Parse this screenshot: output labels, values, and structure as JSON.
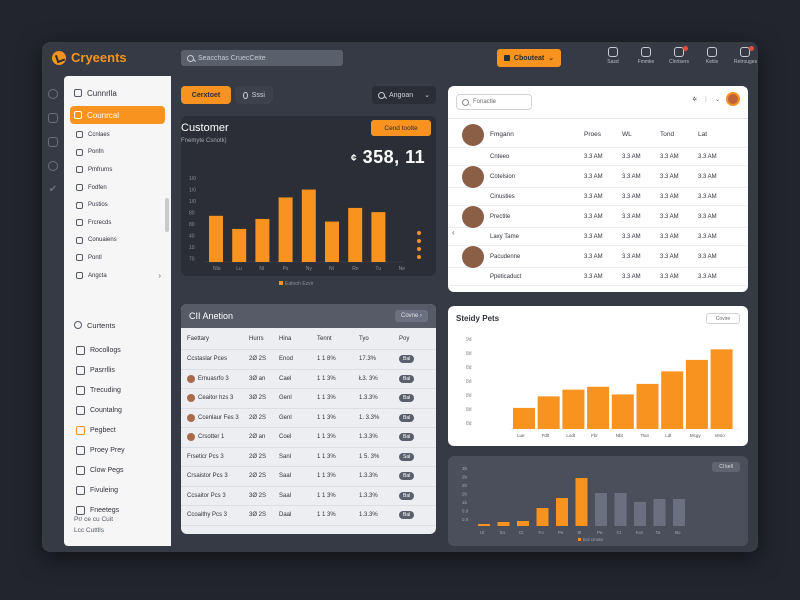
{
  "app": {
    "name": "Cryeents"
  },
  "search": {
    "placeholder": "Seacchas CruecCeite"
  },
  "top_dropdown": {
    "label": "Cbouteat"
  },
  "top_icons": [
    {
      "label": "Sasd",
      "icon": "bell-icon",
      "badge": false
    },
    {
      "label": "Fmmke",
      "icon": "chat-icon",
      "badge": false
    },
    {
      "label": "Clnrtsers",
      "icon": "calendar-icon",
      "badge": true
    },
    {
      "label": "Ketiis",
      "icon": "message-icon",
      "badge": false
    },
    {
      "label": "Retrouges",
      "icon": "user-icon",
      "badge": true
    }
  ],
  "sidebar": {
    "top_items": [
      {
        "label": "Cunnrlla",
        "icon": "home-icon"
      },
      {
        "label": "Counrcal",
        "icon": "customers-icon",
        "active": true
      }
    ],
    "items": [
      {
        "label": "Ccnlaes",
        "icon": "contacts-icon"
      },
      {
        "label": "Ponfn",
        "icon": "users-icon"
      },
      {
        "label": "Pmfrurns",
        "icon": "reports-icon"
      },
      {
        "label": "Fodfen",
        "icon": "folder-icon"
      },
      {
        "label": "Pustios",
        "icon": "settings-icon"
      },
      {
        "label": "Frcrecds",
        "icon": "records-icon"
      },
      {
        "label": "Conuaiens",
        "icon": "database-icon"
      },
      {
        "label": "Pontl",
        "icon": "file-icon"
      },
      {
        "label": "Angcta",
        "icon": "analytics-icon",
        "chevron": "›"
      }
    ],
    "section_title": "Curtents",
    "section_items": [
      {
        "label": "Rocollogs",
        "icon": "doc-icon"
      },
      {
        "label": "Pasrrllis",
        "icon": "user-icon"
      },
      {
        "label": "Trecuding",
        "icon": "calendar-icon"
      },
      {
        "label": "Countalng",
        "icon": "chart-icon"
      },
      {
        "label": "Pegbect",
        "icon": "megaphone-icon",
        "orange": true
      },
      {
        "label": "Proey Prey",
        "icon": "box-icon"
      },
      {
        "label": "Clow Pegs",
        "icon": "tag-icon"
      },
      {
        "label": "Fivuleing",
        "icon": "doc-icon"
      },
      {
        "label": "Fneetegs",
        "icon": "box-icon"
      }
    ],
    "footer": [
      "Pr/ ce cu Cuit",
      "Lcc Cuttlls"
    ]
  },
  "tabs": [
    {
      "label": "Cerxtoet",
      "active": true
    },
    {
      "label": "Sssi",
      "active": false
    }
  ],
  "period_dropdown": {
    "label": "Angoan"
  },
  "customer_card": {
    "title": "Customer",
    "subtitle": "Fnemyte Csnotk)",
    "button": "Cend toolte",
    "big_number": "358, 11",
    "legend": "Eatnoh Ezvir"
  },
  "crm_table": {
    "title": "CII Anetion",
    "control": "Covne",
    "headers": [
      "Faettary",
      "Hurrs",
      "Hina",
      "Tennt",
      "Tyo",
      "Poy"
    ],
    "rows": [
      {
        "name": "Ccstaslar Pces",
        "a": "2Ø 2S",
        "b": "Enod",
        "c": "1 1 8%",
        "d": "17.3%",
        "e": "Bal",
        "avatar": false
      },
      {
        "name": "Emuasrfo 3",
        "a": "3Ø an",
        "b": "Cael",
        "c": "1 1 3%",
        "d": "Ł3. 3%",
        "e": "Bal",
        "avatar": true
      },
      {
        "name": "Ceaitor hzs 3",
        "a": "3Ø 2S",
        "b": "Genl",
        "c": "1 1 3%",
        "d": "1.3.3%",
        "e": "Bal",
        "avatar": true
      },
      {
        "name": "Ccenlaur Fes 3",
        "a": "2Ø 2S",
        "b": "Genl",
        "c": "1 1 3%",
        "d": "1. 3.3%",
        "e": "Bal",
        "avatar": true
      },
      {
        "name": "Crsotter 1",
        "a": "2Ø an",
        "b": "Coel",
        "c": "1 1 3%",
        "d": "1.3.3%",
        "e": "Bal",
        "avatar": true
      },
      {
        "name": "Frseticr Pcs 3",
        "a": "2Ø 2S",
        "b": "Sanl",
        "c": "1 1 3%",
        "d": "1 5. 3%",
        "e": "Sal",
        "avatar": false
      },
      {
        "name": "Crsaistor Pcs 3",
        "a": "2Ø 2S",
        "b": "Saal",
        "c": "1 1 3%",
        "d": "1.3.3%",
        "e": "Bal",
        "avatar": false
      },
      {
        "name": "Ccsaitor Pcs 3",
        "a": "3Ø 2S",
        "b": "Saal",
        "c": "1 1 3%",
        "d": "1.3.3%",
        "e": "Bal",
        "avatar": false
      },
      {
        "name": "Ccoaithy Pcs 3",
        "a": "3Ø 2S",
        "b": "Daal",
        "c": "1 1 3%",
        "d": "1.3.3%",
        "e": "Bal",
        "avatar": false
      }
    ]
  },
  "customer_list": {
    "search_placeholder": "Fonactle",
    "headers": [
      "Fmgann",
      "Proes",
      "WL",
      "Tond",
      "Lat"
    ],
    "rows": [
      {
        "name": "Cnteeo",
        "photo": false,
        "v": [
          "3.3 AM",
          "3.3 AM",
          "3.3 AM",
          "3.3 AM"
        ]
      },
      {
        "name": "Cotelsion",
        "photo": true,
        "v": [
          "3.3 AM",
          "3.3 AM",
          "3.3 AM",
          "3.3 AM"
        ]
      },
      {
        "name": "Cinusties",
        "photo": false,
        "v": [
          "3.3 AM",
          "3.3 AM",
          "3.3 AM",
          "3.3 AM"
        ]
      },
      {
        "name": "Prectite",
        "photo": true,
        "v": [
          "3.3 AM",
          "3.3 AM",
          "3.3 AM",
          "3.3 AM"
        ]
      },
      {
        "name": "Laxy Tame",
        "photo": false,
        "v": [
          "3.3 AM",
          "3.3 AM",
          "3.3 AM",
          "3.3 AM"
        ]
      },
      {
        "name": "Pacudenne",
        "photo": true,
        "v": [
          "3.3 AM",
          "3.3 AM",
          "3.3 AM",
          "3.3 AM"
        ]
      },
      {
        "name": "Ppeticaduct",
        "photo": false,
        "v": [
          "3.3 AM",
          "3.3 AM",
          "3.3 AM",
          "3.3 AM"
        ]
      }
    ]
  },
  "stacked_card": {
    "title": "Steidy Pets",
    "button": "Covire"
  },
  "bottom_card": {
    "button": "Cl kell"
  },
  "colors": {
    "accent": "#f7931e",
    "dark_card": "#2b2e36",
    "panel": "#363a44",
    "background": "#22252d"
  },
  "chart_data": [
    {
      "type": "bar",
      "title": "Customer",
      "categories": [
        "Nla",
        "Lu",
        "Nl",
        "Ps",
        "Ny",
        "Nt",
        "Rn",
        "Tu",
        "Ne"
      ],
      "values": [
        88,
        63,
        82,
        123,
        138,
        77,
        103,
        95,
        0
      ],
      "yticks": [
        "1/0",
        "1/0",
        "1/0",
        "80",
        "80",
        "40",
        "10",
        "70"
      ],
      "ylim": [
        0,
        160
      ],
      "legend": "Eatnoh Ezvir",
      "color": "#f7931e"
    },
    {
      "type": "bar",
      "title": "Steidy Pets",
      "categories": [
        "Lue",
        "Fdlt",
        "Lodt",
        "Fbr",
        "Nbt",
        "Tsut",
        "Ldt",
        "Mcgy",
        "Veso"
      ],
      "values": [
        22,
        34,
        41,
        44,
        36,
        47,
        60,
        72,
        83
      ],
      "yticks": [
        "9d",
        "8d",
        "8d",
        "8d",
        "8d",
        "8d",
        "8d"
      ],
      "ylim": [
        0,
        100
      ],
      "color": "#f7931e"
    },
    {
      "type": "bar",
      "categories": [
        "Ut",
        "So",
        "Ct",
        "Fo",
        "Pe",
        "8t",
        "Pe",
        "Ct",
        "Kot",
        "Ta",
        "Bo"
      ],
      "values": [
        2,
        4,
        5,
        18,
        28,
        48,
        33,
        33,
        24,
        27,
        27
      ],
      "highlight": [
        true,
        true,
        true,
        true,
        true,
        true,
        false,
        false,
        false,
        false,
        false
      ],
      "yticks": [
        "3b",
        "2b",
        "2b",
        "2b",
        "1b",
        "0.0",
        "0.0"
      ],
      "ylim": [
        0,
        60
      ],
      "legend": "Eol cmote",
      "colors": {
        "highlight": "#f7931e",
        "muted": "#6b7080"
      }
    }
  ]
}
